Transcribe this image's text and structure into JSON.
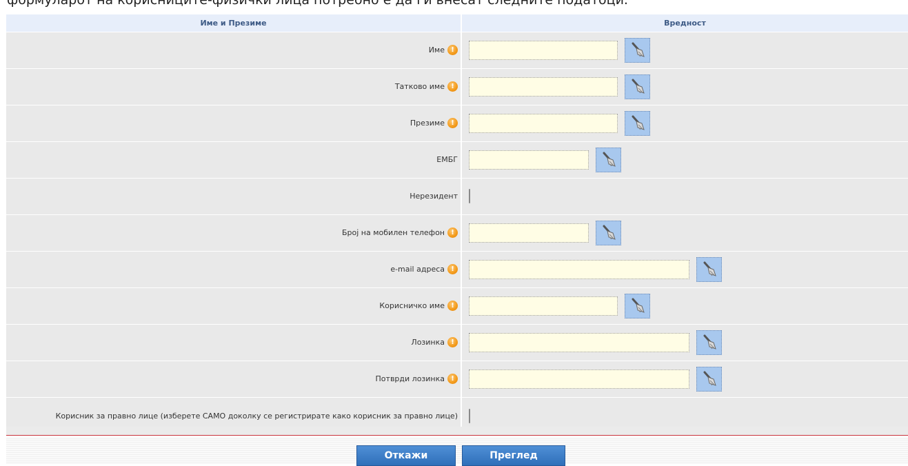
{
  "intro_text": "формуларот на корисниците-физички лица потребно е да ги внесат следните податоци.",
  "header": {
    "col_name": "Име и Презиме",
    "col_value": "Вредност"
  },
  "rows": [
    {
      "label": "Име",
      "required": true,
      "type": "text",
      "value": ""
    },
    {
      "label": "Татково име",
      "required": true,
      "type": "text",
      "value": ""
    },
    {
      "label": "Презиме",
      "required": true,
      "type": "text",
      "value": ""
    },
    {
      "label": "ЕМБГ",
      "required": false,
      "type": "text",
      "value": ""
    },
    {
      "label": "Нерезидент",
      "required": false,
      "type": "checkbox",
      "checked": false
    },
    {
      "label": "Број на мобилен телефон",
      "required": true,
      "type": "text",
      "value": ""
    },
    {
      "label": "e-mail адреса",
      "required": true,
      "type": "text",
      "value": ""
    },
    {
      "label": "Корисничко име",
      "required": true,
      "type": "text",
      "value": ""
    },
    {
      "label": "Лозинка",
      "required": true,
      "type": "password",
      "value": ""
    },
    {
      "label": "Потврди лозинка",
      "required": true,
      "type": "password",
      "value": ""
    },
    {
      "label": "Корисник за правно лице (изберете САМО доколку се регистрирате како корисник за правно лице)",
      "required": false,
      "type": "checkbox",
      "checked": false
    }
  ],
  "buttons": {
    "cancel": "Откажи",
    "preview": "Преглед"
  },
  "icons": {
    "required": "exclamation-icon",
    "clear": "broom-icon"
  },
  "colors": {
    "header_bg": "#e7eefa",
    "header_text": "#3d5a85",
    "row_bg": "#e9e9e9",
    "input_bg": "#fffde5",
    "required_orange": "#f39a1a",
    "button_blue": "#2f6fb9",
    "clear_button_blue": "#a8c8ee",
    "divider_red": "#c8323c"
  }
}
